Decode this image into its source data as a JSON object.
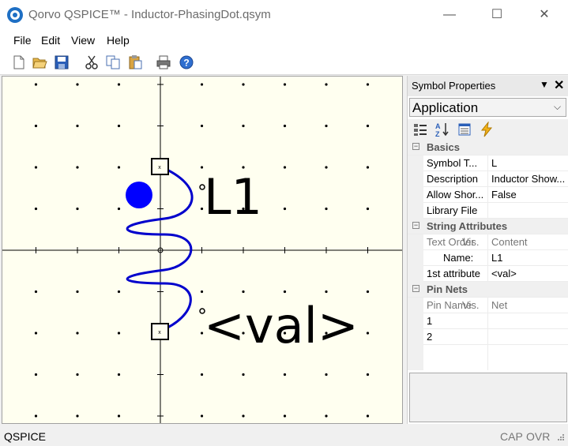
{
  "window": {
    "title": "Qorvo QSPICE™ - Inductor-PhasingDot.qsym",
    "minimize_glyph": "—",
    "maximize_glyph": "☐",
    "close_glyph": "✕"
  },
  "menu": [
    "File",
    "Edit",
    "View",
    "Help"
  ],
  "toolbar": {
    "icons": [
      "new-file-icon",
      "open-folder-icon",
      "save-icon",
      "cut-icon",
      "copy-icon",
      "paste-icon",
      "print-icon",
      "help-icon"
    ]
  },
  "canvas": {
    "background": "#fffff0",
    "wire_color": "#0000cc",
    "dot_color": "#0000ff",
    "labels": {
      "name": "L1",
      "value": "<val>"
    }
  },
  "panel": {
    "title": "Symbol Properties",
    "pin_glyph": "▼",
    "close_glyph": "✕",
    "combo_value": "Application",
    "combo_arrow": "⌵",
    "tool_icons": [
      "categorized-icon",
      "alphabetical-icon",
      "property-pages-icon",
      "events-icon"
    ],
    "sections": [
      {
        "name": "Basics",
        "rows": [
          {
            "name": "Symbol T...",
            "value": "L"
          },
          {
            "name": "Description",
            "value": "Inductor Show..."
          },
          {
            "name": "Allow Shor...",
            "value": "False"
          },
          {
            "name": "Library File",
            "value": ""
          }
        ]
      },
      {
        "name": "String Attributes",
        "header_cells": [
          "Text Order",
          "Vis.",
          "Content"
        ],
        "rows": [
          {
            "name": "Name:",
            "value": "L1"
          },
          {
            "name": "1st attribute",
            "value": "<val>"
          }
        ]
      },
      {
        "name": "Pin Nets",
        "header_cells": [
          "Pin Name",
          "Vis.",
          "Net"
        ],
        "rows": [
          {
            "name": "1",
            "value": ""
          },
          {
            "name": "2",
            "value": ""
          }
        ]
      }
    ]
  },
  "status": {
    "left": "QSPICE",
    "cap": "CAP",
    "ovr": "OVR"
  }
}
